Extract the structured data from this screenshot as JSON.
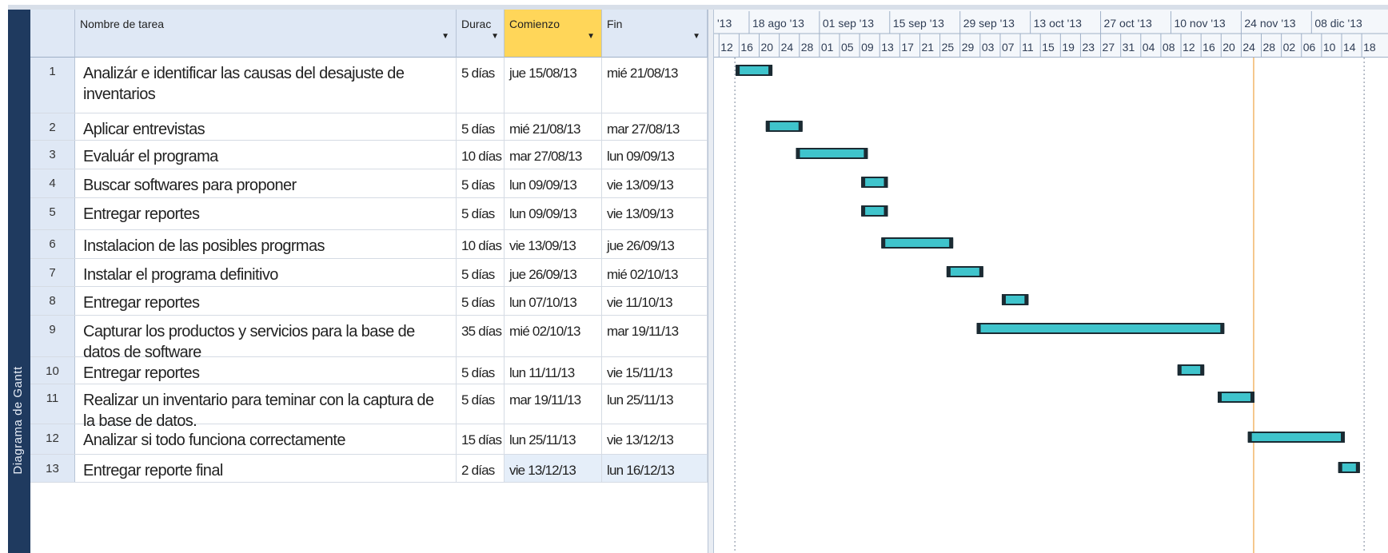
{
  "sidebar": {
    "label": "Diagrama de Gantt"
  },
  "columns": {
    "name": "Nombre de tarea",
    "duration": "Durac",
    "start": "Comienzo",
    "end": "Fin"
  },
  "timescale": {
    "top": [
      "'13",
      "18 ago '13",
      "01 sep '13",
      "15 sep '13",
      "29 sep '13",
      "13 oct '13",
      "27 oct '13",
      "10 nov '13",
      "24 nov '13",
      "08 dic '13"
    ],
    "bottom": [
      "12",
      "16",
      "20",
      "24",
      "28",
      "01",
      "05",
      "09",
      "13",
      "17",
      "21",
      "25",
      "29",
      "03",
      "07",
      "11",
      "15",
      "19",
      "23",
      "27",
      "31",
      "04",
      "08",
      "12",
      "16",
      "20",
      "24",
      "28",
      "02",
      "06",
      "10",
      "14",
      "18"
    ]
  },
  "tasks": [
    {
      "id": "1",
      "name": "Analizár e identificar las causas del desajuste de inventarios",
      "duration": "5 días",
      "start": "jue 15/08/13",
      "end": "mié 21/08/13"
    },
    {
      "id": "2",
      "name": "Aplicar entrevistas",
      "duration": "5 días",
      "start": "mié 21/08/13",
      "end": "mar 27/08/13"
    },
    {
      "id": "3",
      "name": "Evaluár el programa",
      "duration": "10 días",
      "start": "mar 27/08/13",
      "end": "lun 09/09/13"
    },
    {
      "id": "4",
      "name": "Buscar softwares para proponer",
      "duration": "5 días",
      "start": "lun 09/09/13",
      "end": "vie 13/09/13"
    },
    {
      "id": "5",
      "name": "Entregar reportes",
      "duration": "5 días",
      "start": "lun 09/09/13",
      "end": "vie 13/09/13"
    },
    {
      "id": "6",
      "name": "Instalacion de las posibles progrmas",
      "duration": "10 días",
      "start": "vie 13/09/13",
      "end": "jue 26/09/13"
    },
    {
      "id": "7",
      "name": "Instalar el programa definitivo",
      "duration": "5 días",
      "start": "jue 26/09/13",
      "end": "mié 02/10/13"
    },
    {
      "id": "8",
      "name": "Entregar reportes",
      "duration": "5 días",
      "start": "lun 07/10/13",
      "end": "vie 11/10/13"
    },
    {
      "id": "9",
      "name": "Capturar los productos y servicios para la base de datos de software",
      "duration": "35 días",
      "start": "mié 02/10/13",
      "end": "mar 19/11/13"
    },
    {
      "id": "10",
      "name": "Entregar reportes",
      "duration": "5 días",
      "start": "lun 11/11/13",
      "end": "vie 15/11/13"
    },
    {
      "id": "11",
      "name": "Realizar un inventario para teminar con la captura de la base de datos.",
      "duration": "5 días",
      "start": "mar 19/11/13",
      "end": "lun 25/11/13"
    },
    {
      "id": "12",
      "name": "Analizar si todo funciona correctamente",
      "duration": "15 días",
      "start": "lun 25/11/13",
      "end": "vie 13/12/13"
    },
    {
      "id": "13",
      "name": "Entregar reporte final",
      "duration": "2 días",
      "start": "vie 13/12/13",
      "end": "lun 16/12/13"
    }
  ],
  "colors": {
    "bar": "#3fc4cc",
    "bar_border": "#1b2b33",
    "header": "#dfe8f5",
    "start_header": "#ffd659",
    "sidebar": "#1f3a5f",
    "today_line": "#f2b66a"
  }
}
